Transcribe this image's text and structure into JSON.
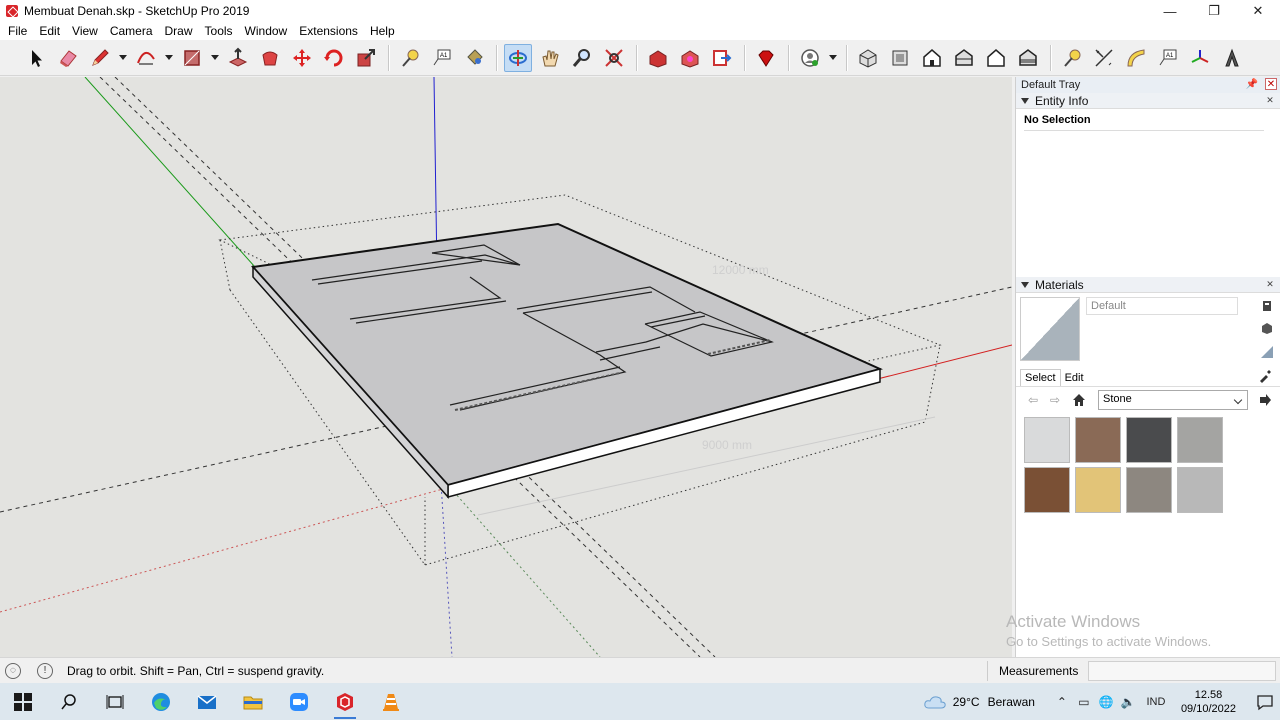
{
  "window": {
    "title": "Membuat Denah.skp - SketchUp Pro 2019",
    "minimize": "—",
    "restore": "❐",
    "close": "✕"
  },
  "menu": [
    "File",
    "Edit",
    "View",
    "Camera",
    "Draw",
    "Tools",
    "Window",
    "Extensions",
    "Help"
  ],
  "viewport": {
    "dim_depth": "12000 mm",
    "dim_width": "9000 mm",
    "colors": {
      "axis_red": "#d32020",
      "axis_green": "#1a9a1a",
      "axis_blue": "#2020d0",
      "background": "#e3e3e0"
    }
  },
  "tray": {
    "title": "Default Tray",
    "entity_info": {
      "title": "Entity Info",
      "selection": "No Selection"
    },
    "materials": {
      "title": "Materials",
      "current_name": "Default",
      "tab_select": "Select",
      "tab_edit": "Edit",
      "library": "Stone",
      "swatch_colors": [
        "#d9dadb",
        "#8a6a56",
        "#4a4b4d",
        "#a4a4a2",
        "#7a5035",
        "#e2c478",
        "#8d8780",
        "#b8b8b8"
      ]
    }
  },
  "watermark": {
    "line1": "Activate Windows",
    "line2": "Go to Settings to activate Windows."
  },
  "status": {
    "message": "Drag to orbit. Shift = Pan, Ctrl = suspend gravity.",
    "measurements_label": "Measurements"
  },
  "taskbar": {
    "weather_temp": "29°C",
    "weather_cond": "Berawan",
    "language": "IND",
    "time": "12.58",
    "date": "09/10/2022"
  }
}
